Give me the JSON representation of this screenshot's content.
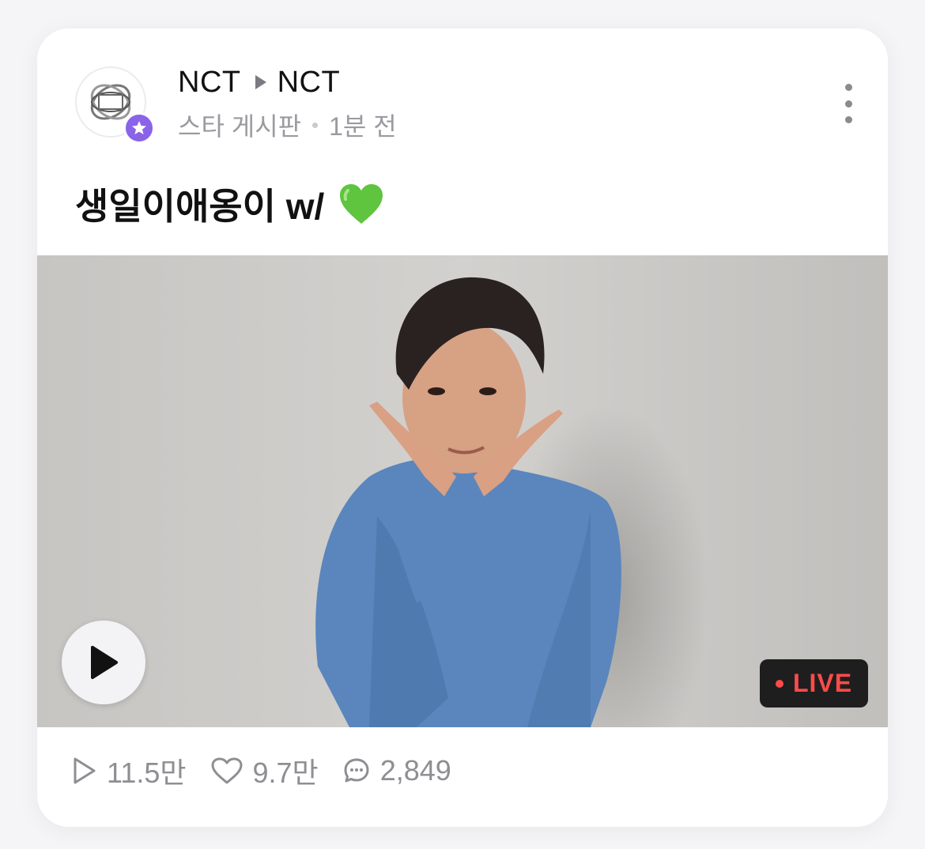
{
  "post": {
    "author": "NCT",
    "target": "NCT",
    "board": "스타 게시판",
    "time": "1분 전",
    "title": "생일이애옹이 w/",
    "title_emoji": "green-heart-emoji",
    "live_label": "LIVE"
  },
  "stats": {
    "plays": "11.5만",
    "likes": "9.7만",
    "comments": "2,849"
  },
  "icons": {
    "badge": "star-icon",
    "more": "more-vertical-icon",
    "play": "play-icon",
    "views": "play-outline-icon",
    "likes": "heart-outline-icon",
    "comments": "chat-bubble-icon"
  },
  "colors": {
    "badge": "#8a63e8",
    "live": "#ff4a4a",
    "stats_text": "#8e8e93",
    "heart": "#5fc43e"
  }
}
